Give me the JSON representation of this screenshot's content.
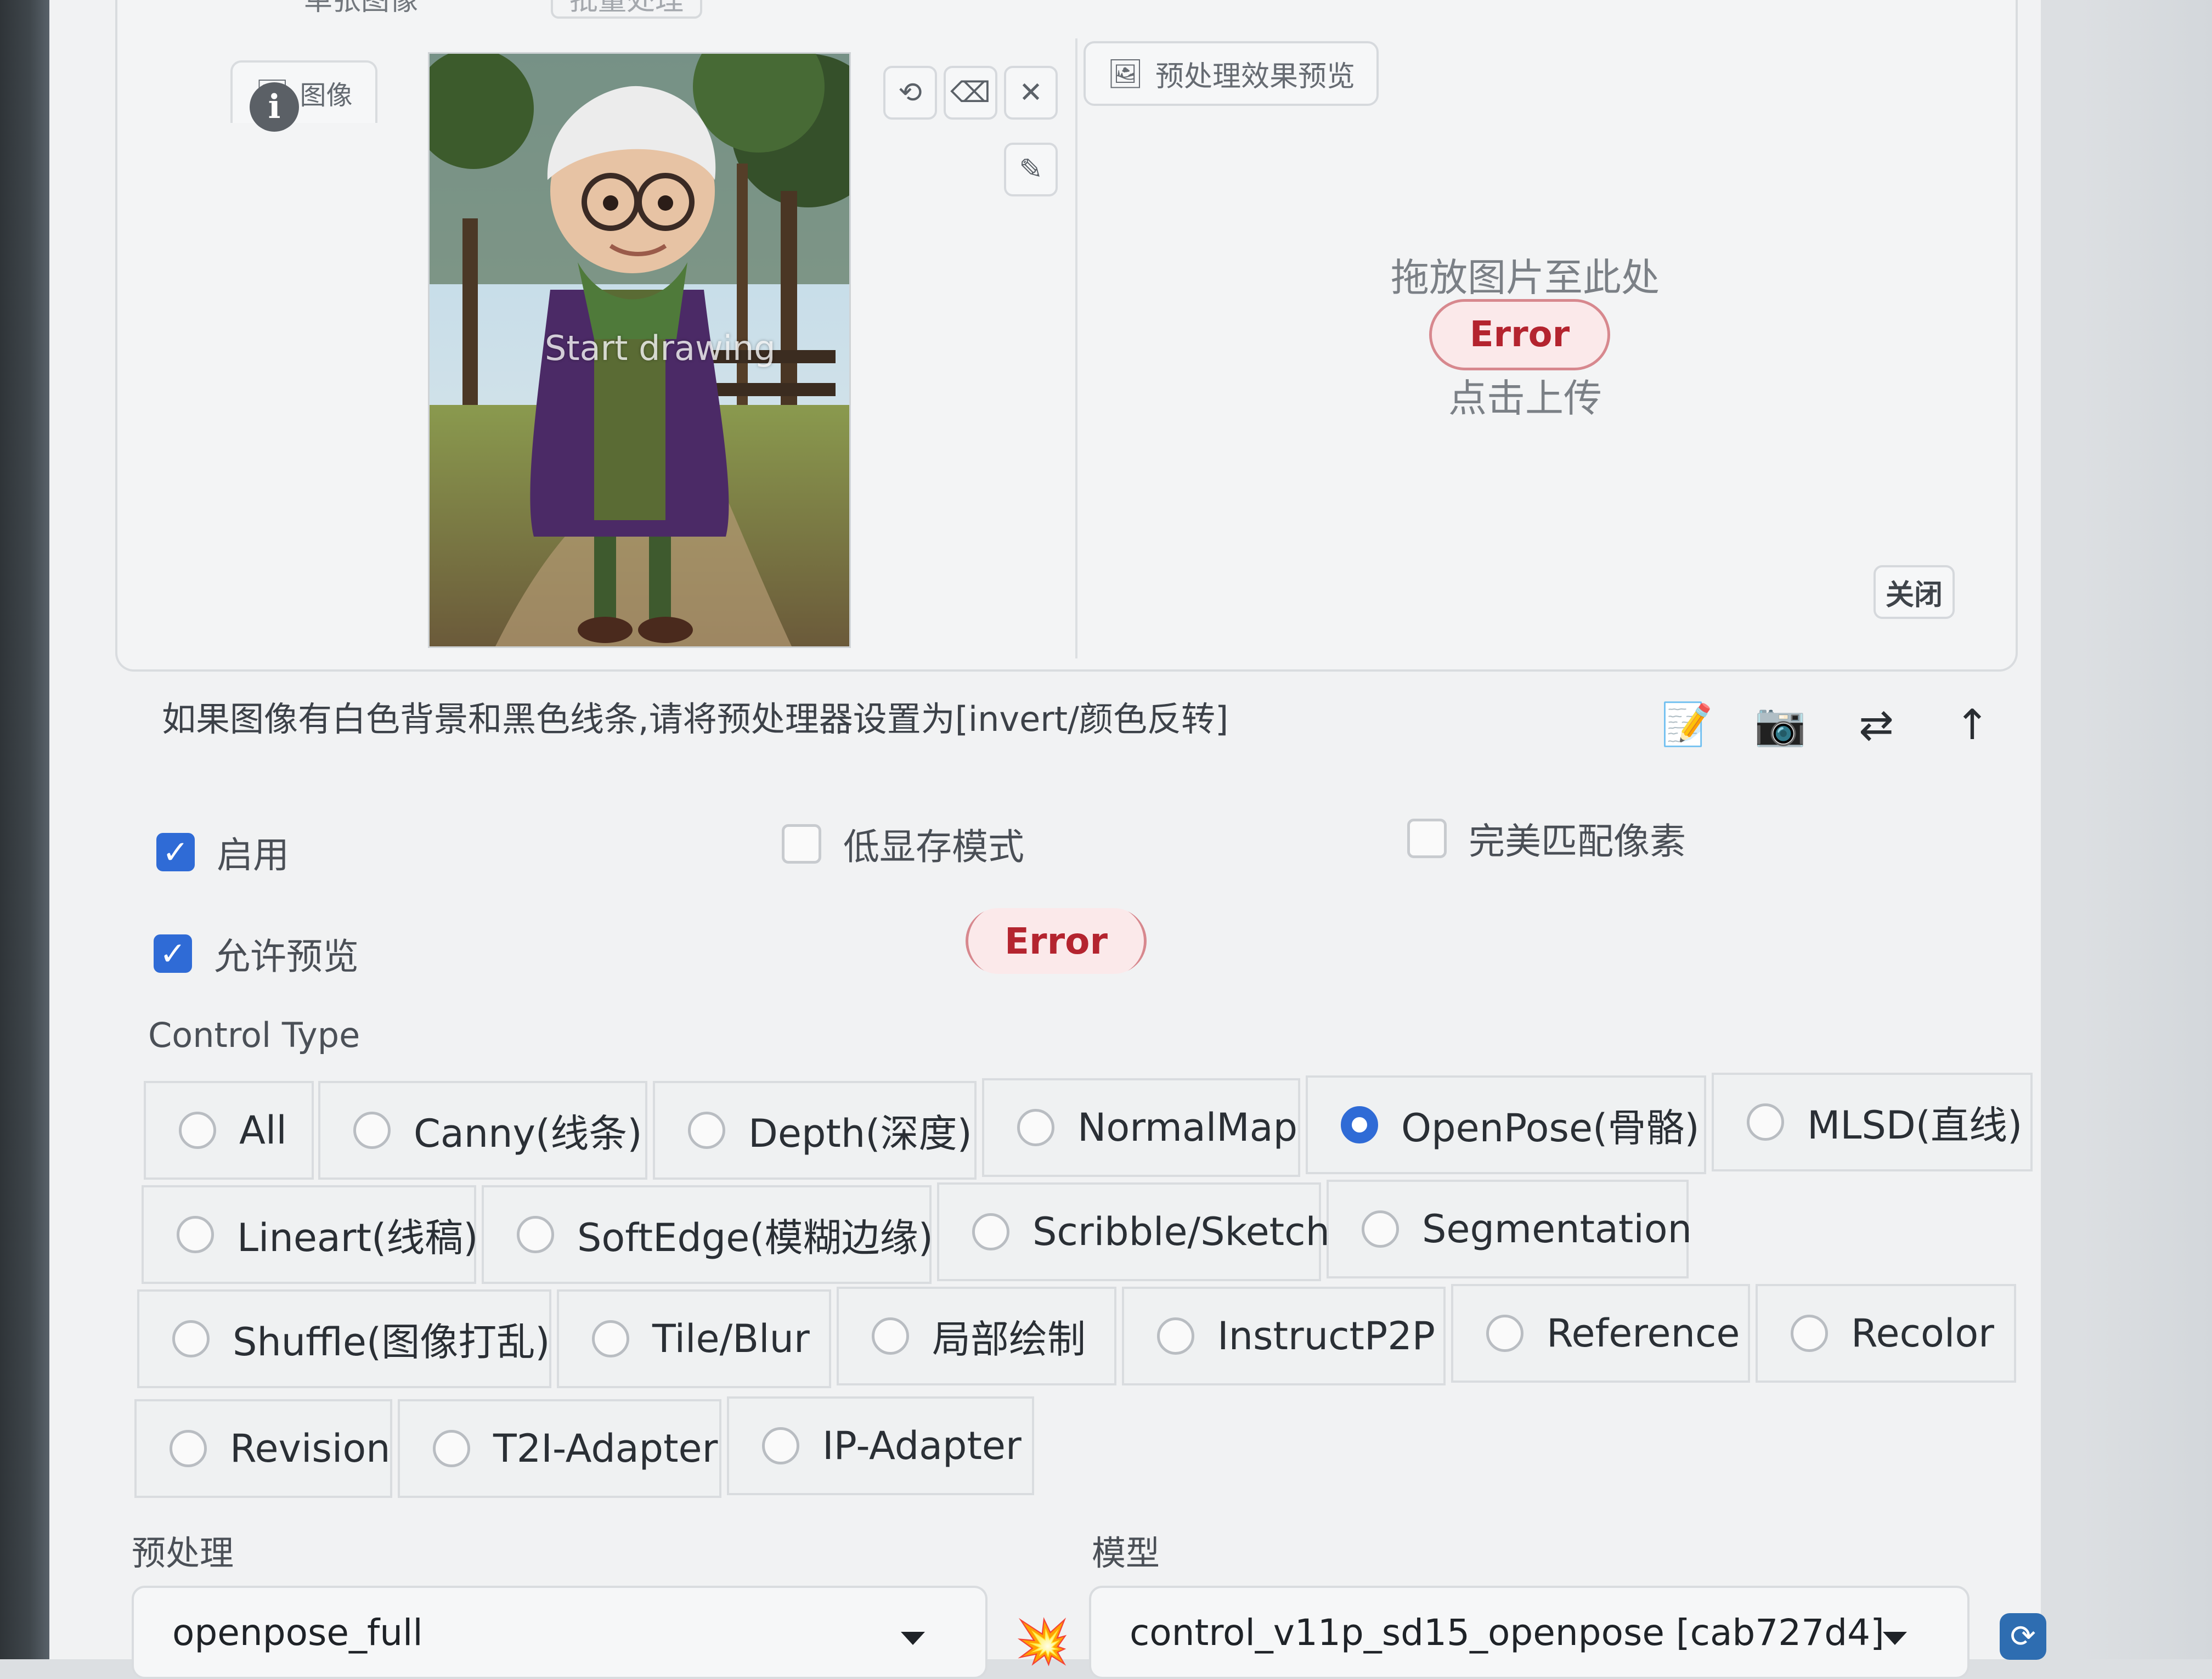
{
  "tabs": {
    "single": "单张图像",
    "batch": "批量处理"
  },
  "image_panel": {
    "subtab_label": "图像",
    "info_badge": "i",
    "draw_hint": "Start drawing"
  },
  "tools": {
    "undo": "⟲",
    "eraser": "⌫",
    "close": "✕",
    "brush": "✎"
  },
  "preview": {
    "tab_label": "预处理效果预览",
    "drop_text": "拖放图片至此处",
    "error": "Error",
    "upload_text": "点击上传",
    "close_label": "关闭"
  },
  "hint_text": "如果图像有白色背景和黑色线条,请将预处理器设置为[invert/颜色反转]",
  "action_icons": {
    "edit": "📝",
    "camera": "📷",
    "swap": "⇄",
    "send": "↑"
  },
  "options": {
    "enable": {
      "label": "启用",
      "checked": true
    },
    "low_vram": {
      "label": "低显存模式",
      "checked": false
    },
    "pixel_perfect": {
      "label": "完美匹配像素",
      "checked": false
    },
    "allow_preview": {
      "label": "允许预览",
      "checked": true
    },
    "preview_error": "Error"
  },
  "control_type": {
    "label": "Control Type",
    "selected": "OpenPose(骨骼)",
    "rows": [
      [
        "All",
        "Canny(线条)",
        "Depth(深度)",
        "NormalMap",
        "OpenPose(骨骼)",
        "MLSD(直线)"
      ],
      [
        "Lineart(线稿)",
        "SoftEdge(模糊边缘)",
        "Scribble/Sketch",
        "Segmentation"
      ],
      [
        "Shuffle(图像打乱)",
        "Tile/Blur",
        "局部绘制",
        "InstructP2P",
        "Reference",
        "Recolor"
      ],
      [
        "Revision",
        "T2I-Adapter",
        "IP-Adapter"
      ]
    ]
  },
  "preprocessor": {
    "label": "预处理",
    "value": "openpose_full"
  },
  "model": {
    "label": "模型",
    "value": "control_v11p_sd15_openpose [cab727d4]"
  },
  "colors": {
    "accent": "#2f6bd6",
    "error_text": "#b4242f",
    "error_bg": "#fbe9ea"
  }
}
